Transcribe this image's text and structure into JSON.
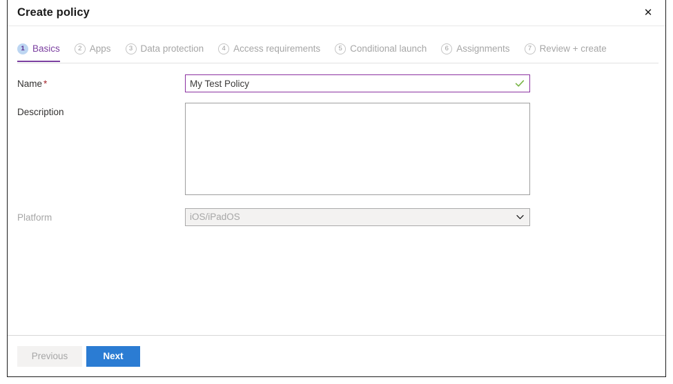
{
  "dialog": {
    "title": "Create policy",
    "close_icon": "close-icon",
    "close_glyph": "✕"
  },
  "tabs": [
    {
      "number": "1",
      "label": "Basics",
      "active": true
    },
    {
      "number": "2",
      "label": "Apps",
      "active": false
    },
    {
      "number": "3",
      "label": "Data protection",
      "active": false
    },
    {
      "number": "4",
      "label": "Access requirements",
      "active": false
    },
    {
      "number": "5",
      "label": "Conditional launch",
      "active": false
    },
    {
      "number": "6",
      "label": "Assignments",
      "active": false
    },
    {
      "number": "7",
      "label": "Review + create",
      "active": false
    }
  ],
  "form": {
    "name": {
      "label": "Name",
      "required_mark": "*",
      "value": "My Test Policy",
      "placeholder": "",
      "validation_icon": "checkmark-icon",
      "valid": true
    },
    "description": {
      "label": "Description",
      "value": "",
      "placeholder": ""
    },
    "platform": {
      "label": "Platform",
      "selected": "iOS/iPadOS",
      "disabled": true,
      "chevron_icon": "chevron-down-icon"
    }
  },
  "footer": {
    "previous_label": "Previous",
    "next_label": "Next"
  },
  "colors": {
    "accent_purple": "#7b3fa0",
    "input_focus_purple": "#8a2fa0",
    "primary_blue": "#2b7cd3",
    "required_red": "#a4262c",
    "valid_green": "#7ab648",
    "badge_active_bg": "#bdd6f2",
    "disabled_text": "#a6a6a6"
  }
}
